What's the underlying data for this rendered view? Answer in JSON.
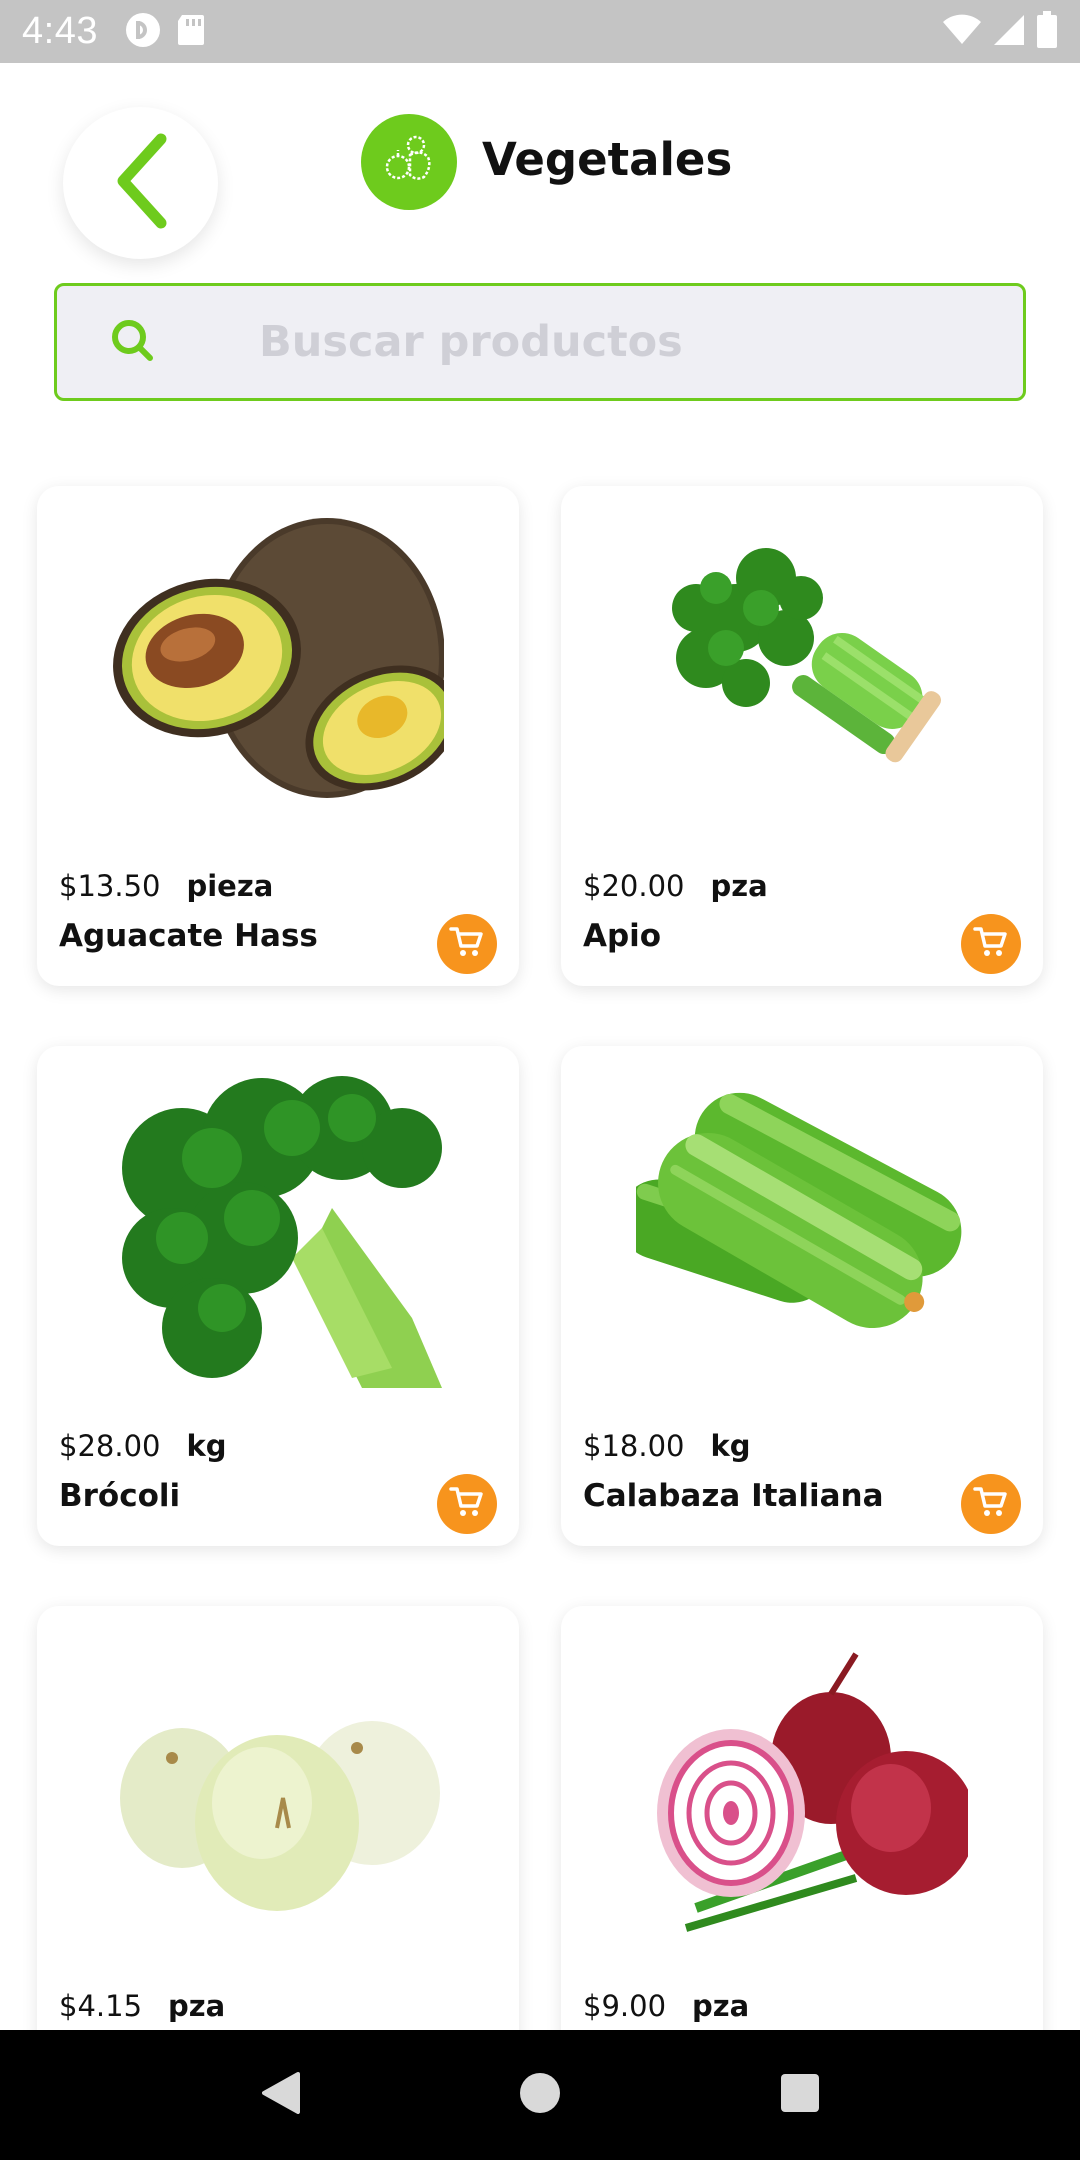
{
  "status_bar": {
    "time": "4:43",
    "icons_left": [
      "pocket-casts-icon",
      "sd-card-icon"
    ],
    "icons_right": [
      "wifi-icon",
      "signal-icon",
      "battery-icon"
    ]
  },
  "header": {
    "back_icon": "chevron-left-icon",
    "category_icon": "vegetables-icon",
    "title": "Vegetales"
  },
  "search": {
    "placeholder": "Buscar productos",
    "value": ""
  },
  "products": [
    {
      "price": "$13.50",
      "unit": "pieza",
      "name": "Aguacate Hass",
      "image": "avocado"
    },
    {
      "price": "$20.00",
      "unit": "pza",
      "name": "Apio",
      "image": "celery"
    },
    {
      "price": "$28.00",
      "unit": "kg",
      "name": "Brócoli",
      "image": "broccoli"
    },
    {
      "price": "$18.00",
      "unit": "kg",
      "name": "Calabaza Italiana",
      "image": "zucchini"
    },
    {
      "price": "$4.15",
      "unit": "pza",
      "name": "",
      "image": "white-onion"
    },
    {
      "price": "$9.00",
      "unit": "pza",
      "name": "",
      "image": "red-onion"
    }
  ],
  "colors": {
    "accent_green": "#6ecb1d",
    "cart_orange": "#f7941d",
    "status_bar": "#c4c4c4",
    "search_bg": "#efeff4"
  },
  "nav_bar": {
    "buttons": [
      "back-triangle-icon",
      "home-circle-icon",
      "recents-square-icon"
    ]
  }
}
